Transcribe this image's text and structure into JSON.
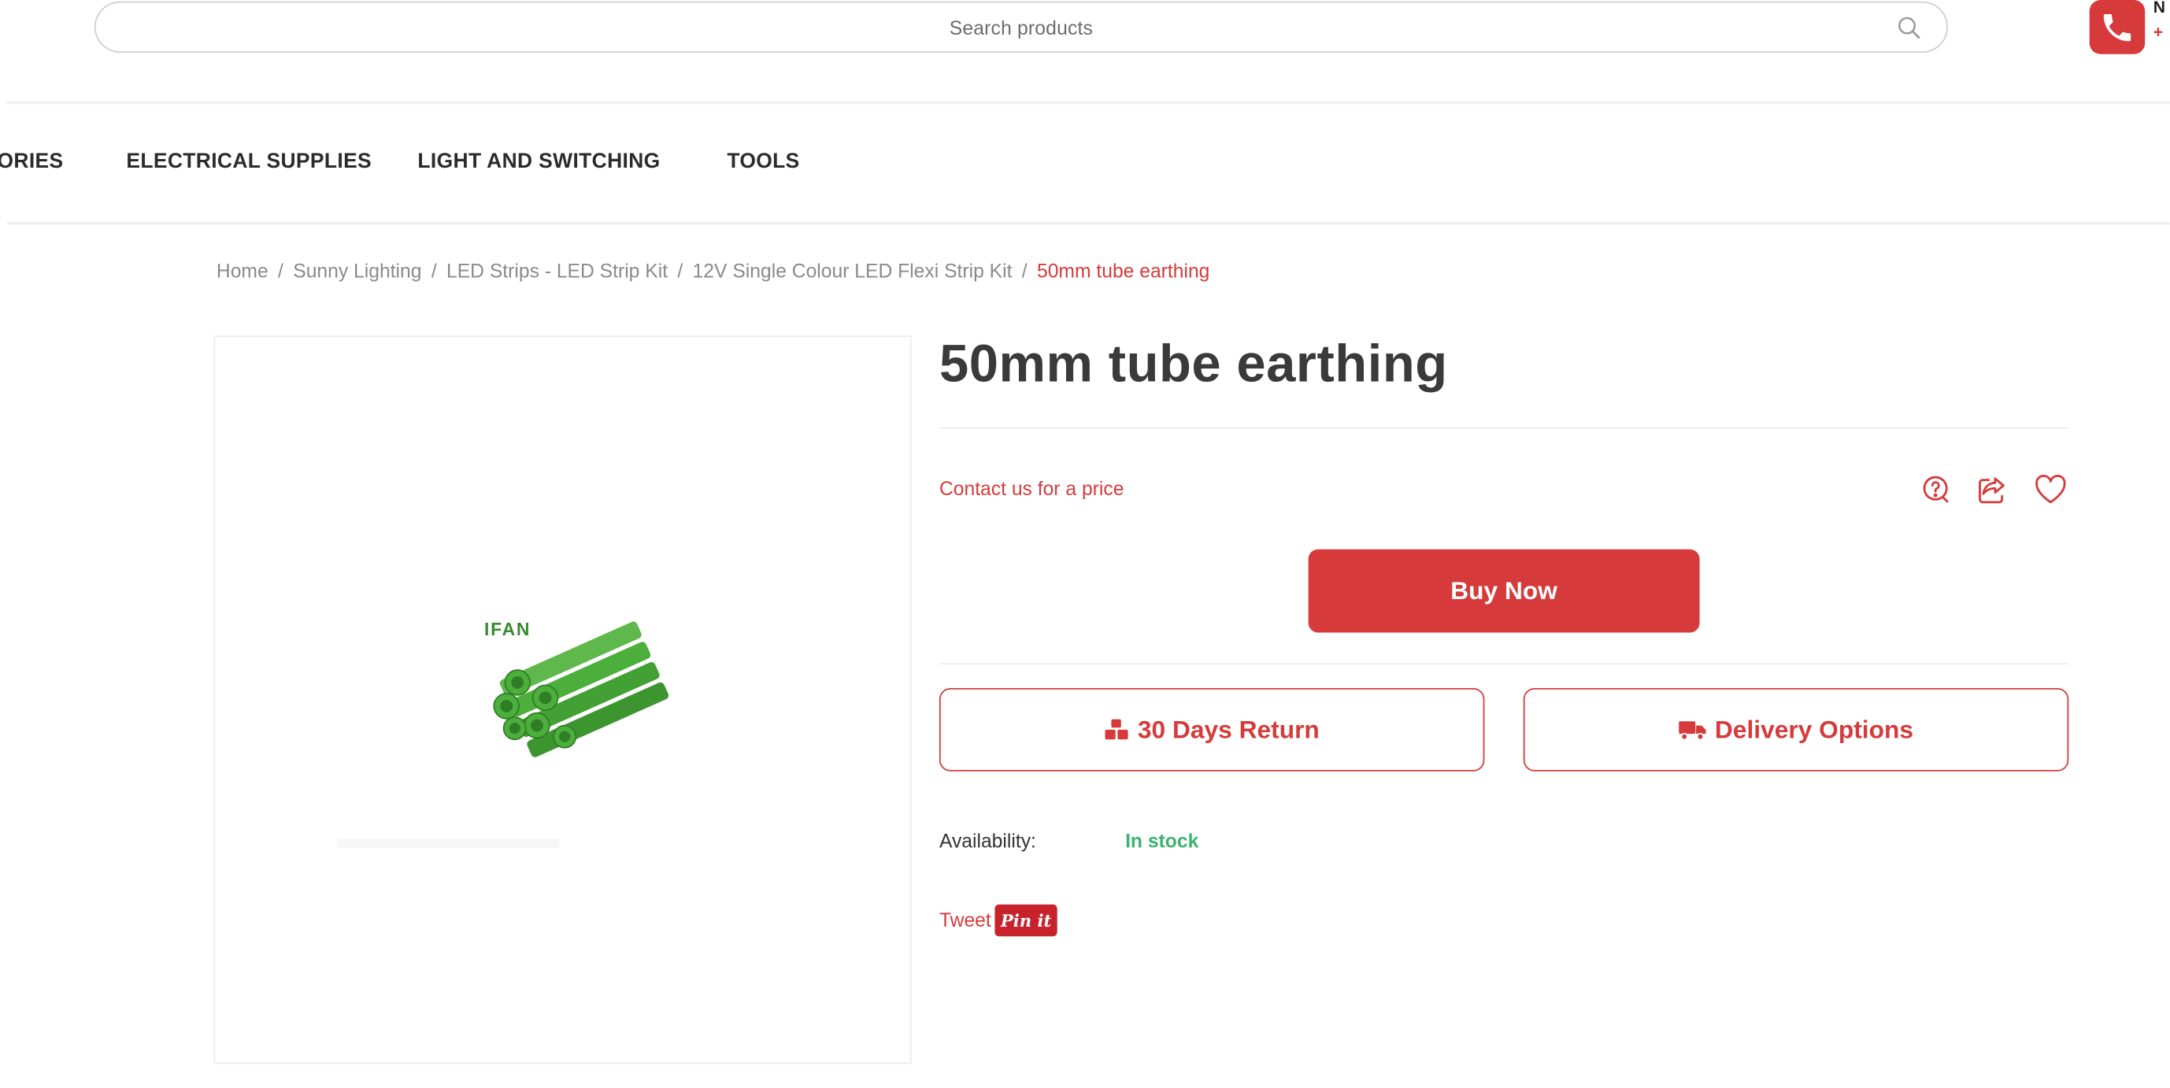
{
  "header": {
    "search": {
      "placeholder": "Search products"
    },
    "phone": {
      "line1": "N",
      "line2": "+"
    }
  },
  "nav": {
    "items": [
      {
        "label": "ORIES"
      },
      {
        "label": "ELECTRICAL SUPPLIES"
      },
      {
        "label": "LIGHT AND SWITCHING"
      },
      {
        "label": "TOOLS"
      }
    ]
  },
  "breadcrumb": {
    "items": [
      {
        "label": "Home"
      },
      {
        "label": "Sunny Lighting"
      },
      {
        "label": "LED Strips - LED Strip Kit"
      },
      {
        "label": "12V Single Colour LED Flexi Strip Kit"
      }
    ],
    "separator": "/",
    "current": "50mm tube earthing"
  },
  "product": {
    "image_brand": "IFAN",
    "title": "50mm tube earthing",
    "price_note": "Contact us for a price",
    "buy_label": "Buy Now",
    "return_label": "30 Days Return",
    "delivery_label": "Delivery Options",
    "availability_label": "Availability:",
    "availability_value": "In stock",
    "tweet_label": "Tweet",
    "pinit_label": "Pin it"
  },
  "icons": {
    "search": "search-icon",
    "phone": "phone-icon",
    "ask": "ask-question-icon",
    "share": "share-icon",
    "wishlist": "heart-icon",
    "return": "return-boxes-icon",
    "delivery": "truck-icon"
  },
  "colors": {
    "accent": "#d63a3a",
    "stock": "#3cb371",
    "pinterest": "#c8232c",
    "pipe_green": "#4caf3c"
  }
}
